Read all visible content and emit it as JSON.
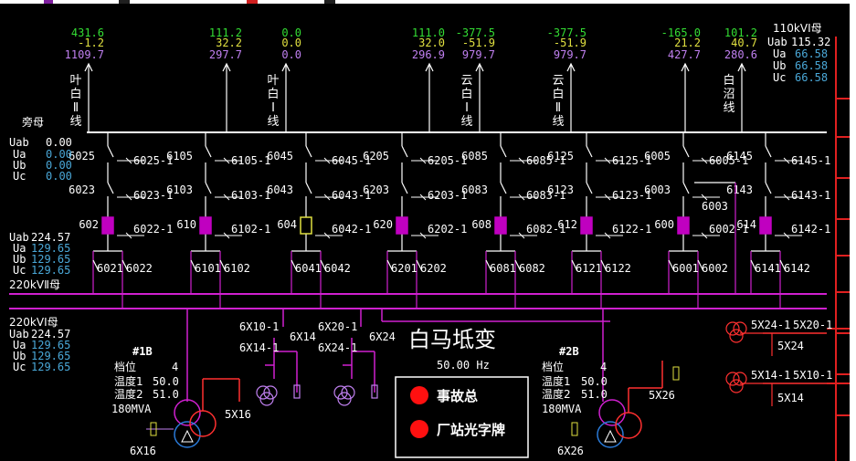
{
  "colors": {
    "busbar": "#d020d0",
    "white": "#ffffff",
    "green": "#33dd33",
    "yellow": "#e0e040",
    "violet": "#c080f0",
    "cyan": "#4aa8d8",
    "red": "#ff2020",
    "breaker_closed": "#c000c0",
    "breaker_open": "#e0e040",
    "transformer_blue": "#2a7ad8",
    "transformer_red": "#ff3030",
    "frame_red": "#e02020"
  },
  "title": {
    "station": "白马坻变",
    "frequency": "50.00 Hz"
  },
  "feeders": [
    {
      "p": "431.6",
      "q": "-1.2",
      "i": "1109.7",
      "name": "叶白Ⅱ线"
    },
    {
      "p": "111.2",
      "q": "32.2",
      "i": "297.7",
      "name": ""
    },
    {
      "p": "0.0",
      "q": "0.0",
      "i": "0.0",
      "name": "叶白Ⅰ线"
    },
    {
      "p": "111.0",
      "q": "32.0",
      "i": "296.9",
      "name": ""
    },
    {
      "p": "-377.5",
      "q": "-51.9",
      "i": "979.7",
      "name": "云白Ⅰ线"
    },
    {
      "p": "-377.5",
      "q": "-51.9",
      "i": "979.7",
      "name": "云白Ⅱ线"
    },
    {
      "p": "-165.0",
      "q": "21.2",
      "i": "427.7",
      "name": ""
    },
    {
      "p": "101.2",
      "q": "40.7",
      "i": "280.6",
      "name": "白沼线"
    }
  ],
  "bus110": {
    "title": "110kVⅠ母",
    "uab_label": "Uab",
    "uab": "115.32",
    "ua_label": "Ua",
    "ua": "66.58",
    "ub_label": "Ub",
    "ub": "66.58",
    "uc_label": "Uc",
    "uc": "66.58"
  },
  "bypass": {
    "title": "旁母",
    "uab_label": "Uab",
    "uab": "0.00",
    "ua_label": "Ua",
    "ua": "0.00",
    "ub_label": "Ub",
    "ub": "0.00",
    "uc_label": "Uc",
    "uc": "0.00"
  },
  "bus2": {
    "title": "220kVⅡ母",
    "uab_label": "Uab",
    "uab": "224.57",
    "ua_label": "Ua",
    "ua": "129.65",
    "ub_label": "Ub",
    "ub": "129.65",
    "uc_label": "Uc",
    "uc": "129.65"
  },
  "bus1": {
    "title": "220kVⅠ母",
    "uab_label": "Uab",
    "uab": "224.57",
    "ua_label": "Ua",
    "ua": "129.65",
    "ub_label": "Ub",
    "ub": "129.65",
    "uc_label": "Uc",
    "uc": "129.65"
  },
  "bays": [
    {
      "top": "6025",
      "top_sw": "6025-1",
      "mid": "6023",
      "mid_sw": "6023-1",
      "brk": "602",
      "brk_sw": "6022-1",
      "b1": "6021",
      "b2": "6022",
      "state": "closed"
    },
    {
      "top": "6105",
      "top_sw": "6105-1",
      "mid": "6103",
      "mid_sw": "6103-1",
      "brk": "610",
      "brk_sw": "6102-1",
      "b1": "6101",
      "b2": "6102",
      "state": "closed"
    },
    {
      "top": "6045",
      "top_sw": "6045-1",
      "mid": "6043",
      "mid_sw": "6043-1",
      "brk": "604",
      "brk_sw": "6042-1",
      "b1": "6041",
      "b2": "6042",
      "state": "open"
    },
    {
      "top": "6205",
      "top_sw": "6205-1",
      "mid": "6203",
      "mid_sw": "6203-1",
      "brk": "620",
      "brk_sw": "6202-1",
      "b1": "6201",
      "b2": "6202",
      "state": "closed"
    },
    {
      "top": "6085",
      "top_sw": "6085-1",
      "mid": "6083",
      "mid_sw": "6083-1",
      "brk": "608",
      "brk_sw": "6082-1",
      "b1": "6081",
      "b2": "6082",
      "state": "closed"
    },
    {
      "top": "6125",
      "top_sw": "6125-1",
      "mid": "6123",
      "mid_sw": "6123-1",
      "brk": "612",
      "brk_sw": "6122-1",
      "b1": "6121",
      "b2": "6122",
      "state": "closed"
    },
    {
      "top": "6005",
      "top_sw": "6005-1",
      "mid": "6003",
      "mid_sw": "",
      "brk": "600",
      "brk_sw": "6002-1",
      "b1": "6001",
      "b2": "6002",
      "state": "closed"
    },
    {
      "top": "6145",
      "top_sw": "6145-1",
      "mid": "6143",
      "mid_sw": "6143-1",
      "brk": "614",
      "brk_sw": "6142-1",
      "b1": "6141",
      "b2": "6142",
      "state": "closed"
    }
  ],
  "t1": {
    "name": "#1B",
    "tap_label": "档位",
    "tap": "4",
    "temp1_label": "温度1",
    "temp1": "50.0",
    "temp2_label": "温度2",
    "temp2": "51.0",
    "capacity": "180MVA",
    "neutral": "6X16",
    "tert_sw": "5X16"
  },
  "t2": {
    "name": "#2B",
    "tap_label": "档位",
    "tap": "4",
    "temp1_label": "温度1",
    "temp1": "50.0",
    "temp2_label": "温度2",
    "temp2": "51.0",
    "capacity": "180MVA",
    "neutral": "6X26",
    "tert_sw": "5X26"
  },
  "pt_switches": {
    "a1": "6X10-1",
    "a2": "6X14-1",
    "a3": "6X14",
    "b1": "6X20-1",
    "b2": "6X24-1",
    "b3": "6X24"
  },
  "right_switches": {
    "a1": "5X24-1",
    "a2": "5X20-1",
    "a3": "5X24",
    "b1": "5X14-1",
    "b2": "5X10-1",
    "b3": "5X14"
  },
  "alarms": [
    {
      "label": "事故总",
      "color": "#ff1010"
    },
    {
      "label": "厂站光字牌",
      "color": "#ff1010"
    }
  ]
}
